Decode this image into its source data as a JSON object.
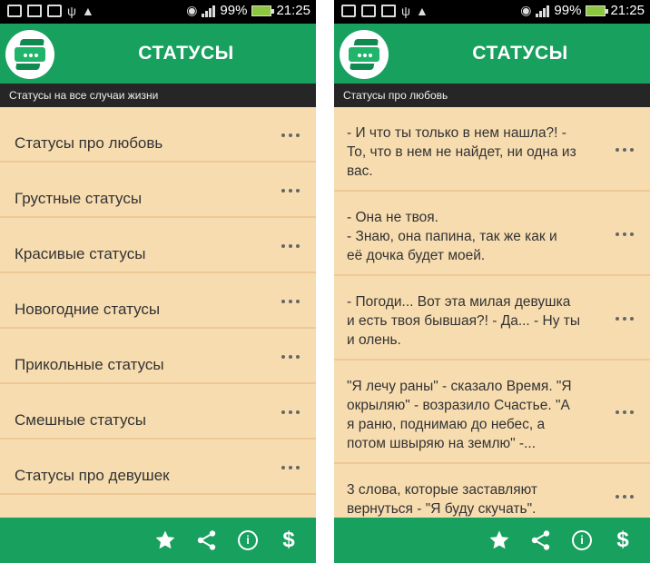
{
  "status_bar": {
    "battery": "99%",
    "time": "21:25"
  },
  "app": {
    "title": "СТАТУСЫ"
  },
  "left": {
    "subtitle": "Статусы на все случаи жизни",
    "categories": [
      {
        "label": "Статусы про любовь"
      },
      {
        "label": "Грустные статусы"
      },
      {
        "label": "Красивые статусы"
      },
      {
        "label": "Новогодние статусы"
      },
      {
        "label": "Прикольные статусы"
      },
      {
        "label": "Смешные статусы"
      },
      {
        "label": "Статусы про девушек"
      }
    ]
  },
  "right": {
    "subtitle": "Статусы про любовь",
    "statuses": [
      {
        "text": "- И что ты только в нем нашла?! -\nТо, что в нем не найдет, ни одна из\nвас."
      },
      {
        "text": "- Она не твоя.\n - Знаю, она папина, так же как и\nеё дочка будет моей."
      },
      {
        "text": "- Погоди... Вот эта милая девушка\nи есть твоя бывшая?! - Да... - Ну ты\nи олень."
      },
      {
        "text": "\"Я лечу раны\" - сказало Время. \"Я\nокрыляю\" - возразило Счастье. \"А\nя раню, поднимаю до небес, а\nпотом швыряю на землю\" -..."
      },
      {
        "text": "3 слова, которые заставляют\nвернуться - \"Я буду скучать\"."
      }
    ]
  },
  "bottom_bar": {
    "icons": [
      "star-icon",
      "share-icon",
      "info-icon",
      "dollar-icon"
    ],
    "info_glyph": "i",
    "dollar_glyph": "$"
  },
  "colors": {
    "primary_green": "#18a05e",
    "list_background": "#f7dcb0",
    "divider": "#eec896",
    "subbar": "#262626"
  }
}
